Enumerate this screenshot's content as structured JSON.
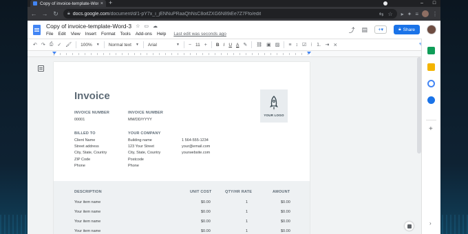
{
  "browser": {
    "tab_title": "Copy of invoice-template-Word-3",
    "url_domain": "docs.google.com",
    "url_path": "/document/d/1-pY7x_i_jENNuPRaaQhNsC8oifZXG6N89iEe7Z7Ffo/edit"
  },
  "docs": {
    "title": "Copy of invoice-template-Word-3",
    "menu": [
      "File",
      "Edit",
      "View",
      "Insert",
      "Format",
      "Tools",
      "Add-ons",
      "Help"
    ],
    "last_edit": "Last edit was seconds ago",
    "share_label": "Share"
  },
  "toolbar": {
    "zoom": "100%",
    "style": "Normal text",
    "font": "Arial",
    "font_size": "11",
    "bold": "B",
    "italic": "I",
    "underline": "U",
    "text_color": "A"
  },
  "invoice": {
    "title": "Invoice",
    "logo_text": "YOUR LOGO",
    "invoice_number_label": "INVOICE NUMBER",
    "invoice_number": "00001",
    "date_label": "INVOICE NUMBER",
    "date_value": "MM/DD/YYYY",
    "billed_to_label": "BILLED TO",
    "billed_to": [
      "Client Name",
      "Street address",
      "City, State, Country",
      "ZIP Code",
      "Phone"
    ],
    "company_label": "YOUR COMPANY",
    "company": [
      "Building name",
      "123 Your Street",
      "City, State, Country",
      "Postcode",
      "Phone"
    ],
    "contact": [
      "1 564-555-1234",
      "your@email.com",
      "yourwebsite.com"
    ],
    "table_headers": {
      "description": "DESCRIPTION",
      "unit_cost": "UNIT COST",
      "qty": "QTY/HR RATE",
      "amount": "AMOUNT"
    },
    "rows": [
      {
        "name": "Your item name",
        "cost": "$0.00",
        "qty": "1",
        "amount": "$0.00"
      },
      {
        "name": "Your item name",
        "cost": "$0.00",
        "qty": "1",
        "amount": "$0.00"
      },
      {
        "name": "Your item name",
        "cost": "$0.00",
        "qty": "1",
        "amount": "$0.00"
      },
      {
        "name": "Your item name",
        "cost": "$0.00",
        "qty": "1",
        "amount": "$0.00"
      }
    ]
  },
  "colors": {
    "share_blue": "#1a73e8",
    "heading_gray": "#5d6a75"
  }
}
